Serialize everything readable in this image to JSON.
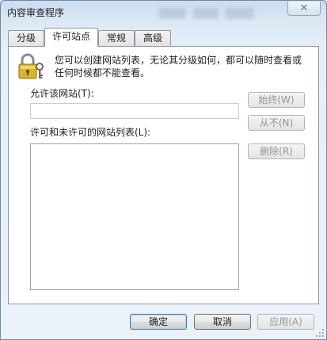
{
  "window": {
    "title": "内容审查程序",
    "close_glyph": "✕"
  },
  "tabs": [
    {
      "label": "分级"
    },
    {
      "label": "许可站点"
    },
    {
      "label": "常规"
    },
    {
      "label": "高级"
    }
  ],
  "active_tab": "许可站点",
  "intro_text": "您可以创建网站列表，无论其分级如何，都可以随时查看或任何时候都不能查看。",
  "allow_site": {
    "label": "允许该网站(T):",
    "value": "",
    "always_button": "始终(W)",
    "never_button": "从不(N)"
  },
  "site_list": {
    "label": "许可和未许可的网站列表(L):",
    "items": [],
    "remove_button": "删除(R)"
  },
  "footer": {
    "ok_button": "确定",
    "cancel_button": "取消",
    "apply_button": "应用(A)"
  },
  "icons": {
    "lock": "lock-key-icon"
  },
  "colors": {
    "title_bar": "#c9dcee",
    "panel": "#ffffff",
    "disabled_text": "#8f969d"
  }
}
